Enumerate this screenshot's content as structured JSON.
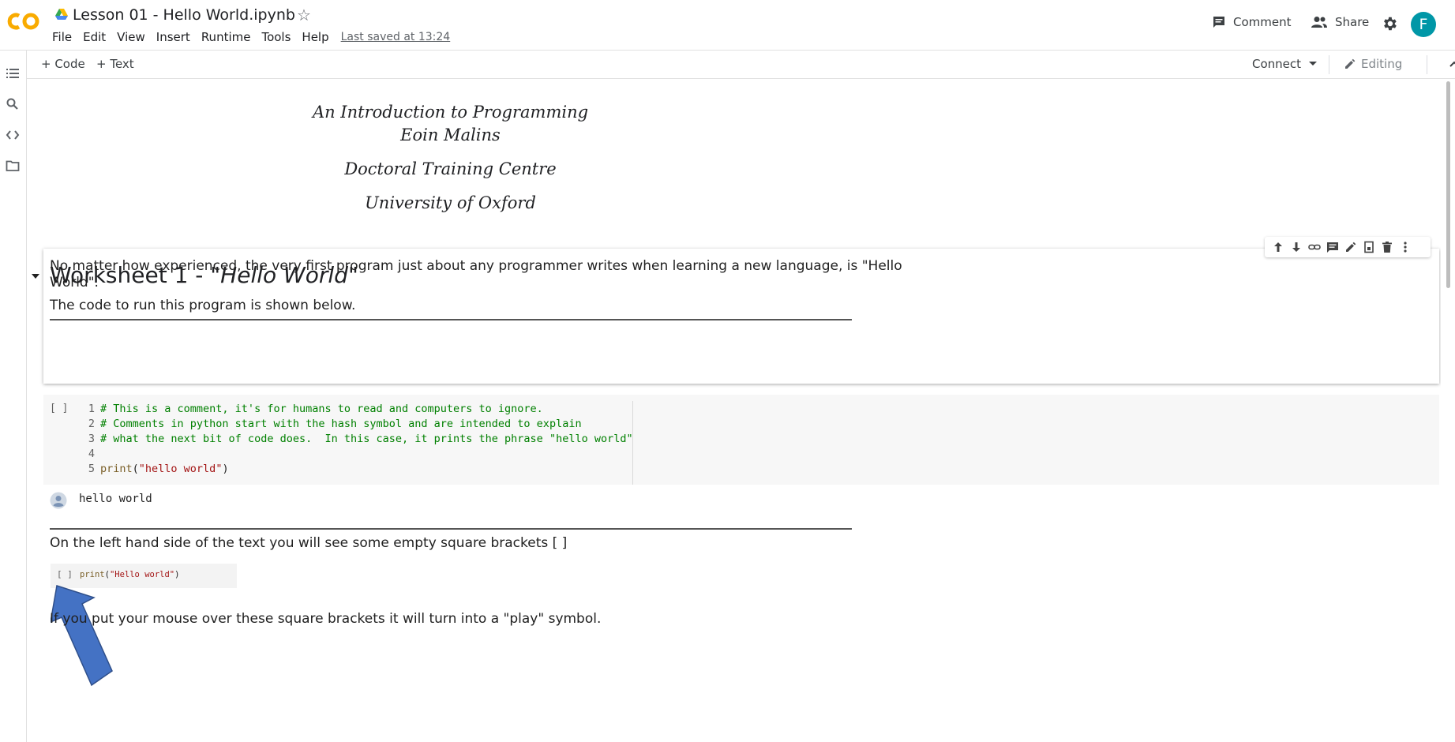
{
  "app": {
    "title": "Lesson 01 - Hello World.ipynb",
    "last_saved": "Last saved at 13:24",
    "menu": [
      "File",
      "Edit",
      "View",
      "Insert",
      "Runtime",
      "Tools",
      "Help"
    ],
    "comment_label": "Comment",
    "share_label": "Share",
    "avatar_initial": "F",
    "brand_color": "#f9ab00",
    "avatar_color": "#0097a7"
  },
  "left_rail": {
    "icons": [
      "table-of-contents-icon",
      "search-icon",
      "code-snippets-icon",
      "files-icon"
    ]
  },
  "toolbar": {
    "add_code": "+ Code",
    "add_text": "+ Text",
    "connect": "Connect",
    "editing": "Editing"
  },
  "notebook": {
    "title_cell": {
      "line1": "An Introduction to Programming",
      "line2": "Eoin Malins",
      "line3": "Doctoral Training Centre",
      "line4": "University of Oxford"
    },
    "worksheet": {
      "heading_prefix": "Worksheet 1 - \"",
      "heading_italic": "Hello World",
      "heading_suffix": "\"",
      "para1_line1": "No matter how experienced, the very first program just about any programmer writes when learning a new language, is \"Hello",
      "para1_line2": "World\".",
      "para2": "The code to run this program is shown below."
    },
    "cell_toolbar_icons": [
      "move-up-icon",
      "move-down-icon",
      "link-icon",
      "comment-icon",
      "edit-icon",
      "mirror-cell-icon",
      "delete-icon",
      "more-icon"
    ],
    "code_cell": {
      "run_brackets": "[ ]",
      "lines": [
        {
          "n": "1",
          "text": "# This is a comment, it's for humans to read and computers to ignore."
        },
        {
          "n": "2",
          "text": "# Comments in python start with the hash symbol and are intended to explain"
        },
        {
          "n": "3",
          "text": "# what the next bit of code does.  In this case, it prints the phrase \"hello world\""
        },
        {
          "n": "4",
          "text": ""
        },
        {
          "n": "5",
          "kw": "print",
          "open": "(",
          "str": "\"hello world\"",
          "close": ")"
        }
      ],
      "output": "hello world"
    },
    "after_code": {
      "brackets_text": "On the left hand side of the text you will see some empty square brackets [ ]",
      "image_brackets": "[ ]",
      "image_code_kw": "print",
      "image_code_open": "(",
      "image_code_str": "\"Hello world\"",
      "image_code_close": ")",
      "arrow_color": "#4472c4",
      "hover_text": "If you put your mouse over these square brackets it will turn into a \"play\" symbol."
    }
  }
}
